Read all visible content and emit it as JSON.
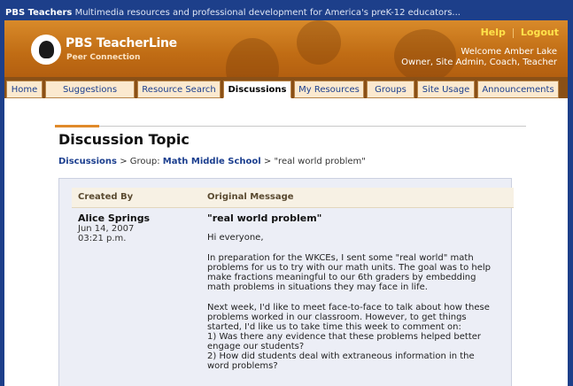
{
  "topbar": {
    "brand": "PBS Teachers",
    "tagline": "Multimedia resources and professional development for America's preK-12 educators..."
  },
  "header": {
    "logo_title": "PBS TeacherLine",
    "logo_subtitle": "Peer Connection",
    "help": "Help",
    "logout": "Logout",
    "welcome_line1": "Welcome Amber Lake",
    "welcome_line2": "Owner, Site Admin, Coach, Teacher"
  },
  "nav": {
    "tabs": [
      {
        "label": "Home"
      },
      {
        "label": "Suggestions"
      },
      {
        "label": "Resource Search"
      },
      {
        "label": "Discussions"
      },
      {
        "label": "My Resources"
      },
      {
        "label": "Groups"
      },
      {
        "label": "Site Usage"
      },
      {
        "label": "Announcements"
      }
    ],
    "active": "Discussions"
  },
  "page": {
    "title": "Discussion Topic",
    "breadcrumb": {
      "root": "Discussions",
      "sep": ">",
      "group_prefix": "Group:",
      "group": "Math Middle School",
      "topic": "\"real world problem\""
    }
  },
  "table": {
    "col_created": "Created By",
    "col_original": "Original Message",
    "author": "Alice Springs",
    "date": "Jun 14, 2007",
    "time": "03:21 p.m.",
    "subject": "\"real world problem\"",
    "greeting": "Hi everyone,",
    "para1": "In preparation for the WKCEs, I sent some \"real world\" math\nproblems for us to try with our math units. The goal was to help\nmake fractions meaningful to our 6th graders by embedding\nmath problems in situations they may face in life.",
    "para2": "Next week, I'd like to meet face-to-face to talk about how these\nproblems worked in our classroom. However, to get things\nstarted, I'd like us to take time this week to comment on:\n1) Was there any evidence that these problems helped better\nengage our students?\n2) How did students deal with extraneous information in the\nword problems?"
  },
  "colors": {
    "brand_blue": "#1d3f8a",
    "banner_orange": "#c06c14",
    "accent": "#e08a2a",
    "link": "#1c3f8f"
  }
}
